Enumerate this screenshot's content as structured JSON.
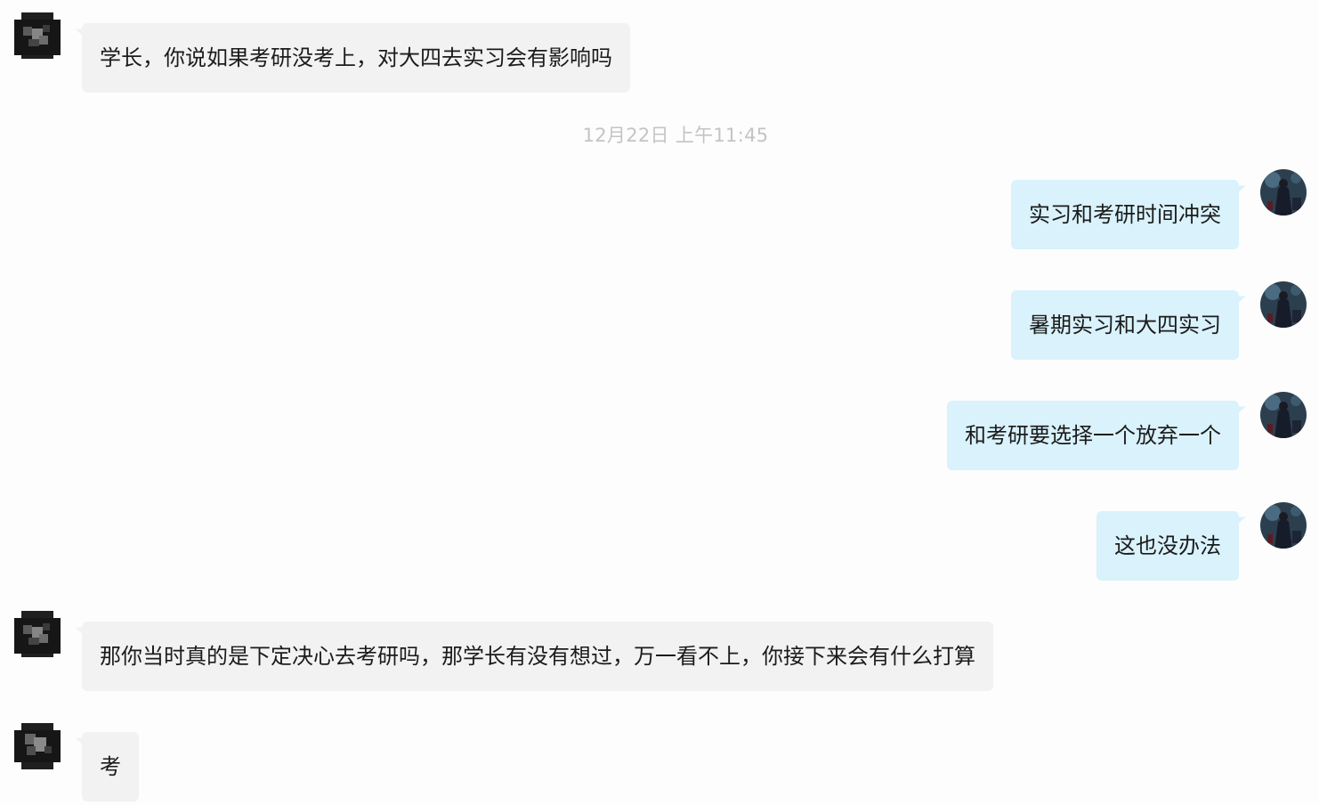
{
  "timestamp": "12月22日  上午11:45",
  "messages": [
    {
      "sender": "them",
      "text": "学长，你说如果考研没考上，对大四去实习会有影响吗"
    },
    {
      "sender": "me",
      "text": "实习和考研时间冲突"
    },
    {
      "sender": "me",
      "text": "暑期实习和大四实习"
    },
    {
      "sender": "me",
      "text": "和考研要选择一个放弃一个"
    },
    {
      "sender": "me",
      "text": "这也没办法"
    },
    {
      "sender": "them",
      "text": "那你当时真的是下定决心去考研吗，那学长有没有想过，万一看不上，你接下来会有什么打算"
    },
    {
      "sender": "them",
      "text": "考"
    }
  ],
  "colors": {
    "background": "#fdfdfd",
    "incoming_bubble": "#f2f2f2",
    "outgoing_bubble": "#d9f2fb",
    "timestamp": "#c4c4c4",
    "text": "#1b1b1b"
  },
  "icons": {
    "contact_avatar": "pixelated-avatar-icon",
    "user_avatar": "user-avatar-icon"
  }
}
